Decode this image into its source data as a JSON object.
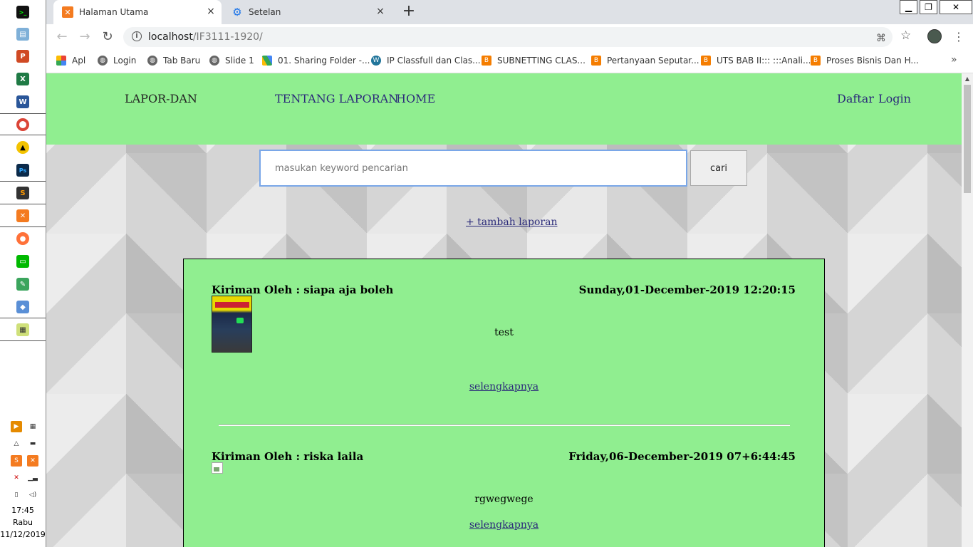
{
  "taskbar": {
    "clock": {
      "time": "17:45",
      "day": "Rabu",
      "date": "11/12/2019"
    }
  },
  "browser": {
    "tabs": [
      {
        "title": "Halaman Utama",
        "active": true
      },
      {
        "title": "Setelan",
        "active": false
      }
    ],
    "url": {
      "host": "localhost",
      "path": "/IF3111-1920/"
    },
    "bookmarks": [
      {
        "label": "Apl",
        "icon": "apps-grid-icon"
      },
      {
        "label": "Login",
        "icon": "globe-icon"
      },
      {
        "label": "Tab Baru",
        "icon": "globe-icon"
      },
      {
        "label": "Slide 1",
        "icon": "globe-icon"
      },
      {
        "label": "01. Sharing Folder -...",
        "icon": "google-drive-icon"
      },
      {
        "label": "IP Classfull dan Clas...",
        "icon": "wordpress-icon"
      },
      {
        "label": "SUBNETTING CLAS...",
        "icon": "blogger-icon"
      },
      {
        "label": "Pertanyaan Seputar...",
        "icon": "blogger-icon"
      },
      {
        "label": "UTS BAB II::: :::Anali...",
        "icon": "blogger-icon"
      },
      {
        "label": "Proses Bisnis Dan H...",
        "icon": "blogger-icon"
      }
    ]
  },
  "site": {
    "nav": {
      "brand": "LAPOR-DAN",
      "about": "TENTANG LAPORAN",
      "home": "HOME",
      "register": "Daftar",
      "login": "Login"
    },
    "search": {
      "placeholder": "masukan keyword pencarian",
      "button": "cari"
    },
    "add_report": "+ tambah laporan",
    "reports": [
      {
        "author": "Kiriman Oleh : siapa aja boleh",
        "date": "Sunday,01-December-2019 12:20:15",
        "text": "test",
        "more": "selengkapnya"
      },
      {
        "author": "Kiriman Oleh : riska laila",
        "date": "Friday,06-December-2019 07+6:44:45",
        "text": "rgwegwege",
        "more": "selengkapnya"
      }
    ]
  },
  "colors": {
    "navbar": "#90ee90",
    "link": "#2b2b7a",
    "search_border": "#7aa7e8"
  }
}
